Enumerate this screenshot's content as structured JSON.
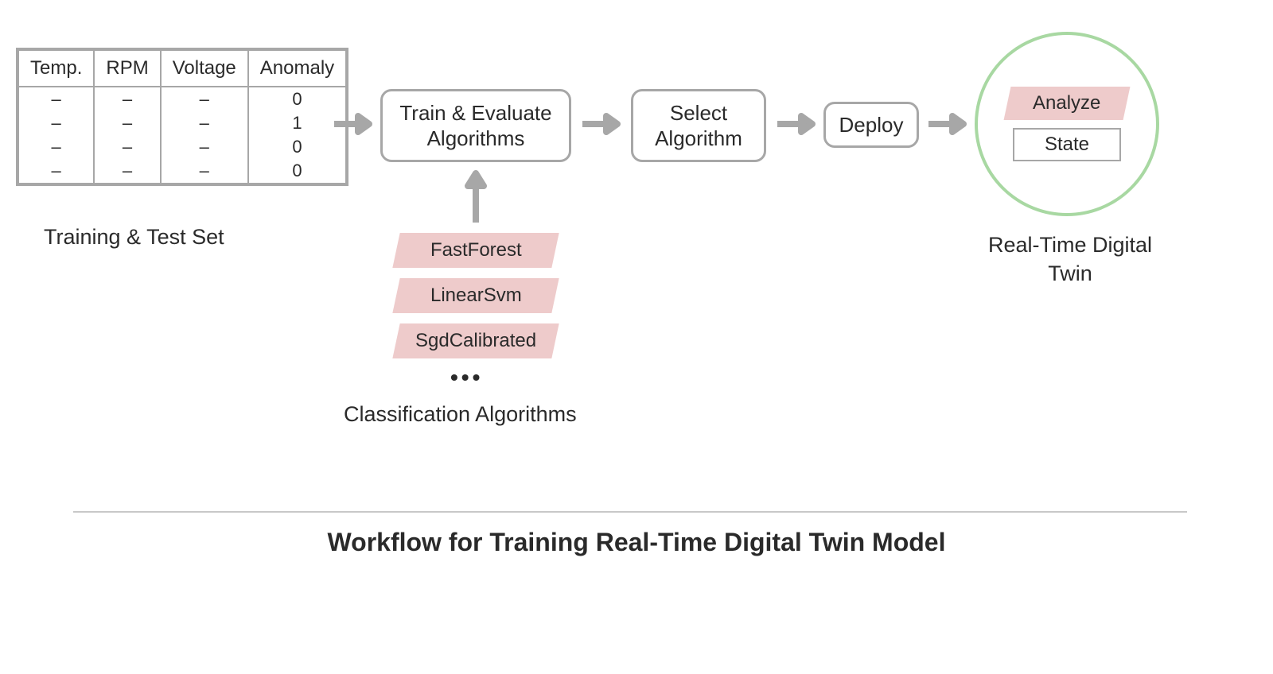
{
  "table": {
    "headers": [
      "Temp.",
      "RPM",
      "Voltage",
      "Anomaly"
    ],
    "rows": [
      [
        "–",
        "–",
        "–",
        "0"
      ],
      [
        "–",
        "–",
        "–",
        "1"
      ],
      [
        "–",
        "–",
        "–",
        "0"
      ],
      [
        "–",
        "–",
        "–",
        "0"
      ]
    ],
    "caption": "Training & Test Set"
  },
  "flow": {
    "train": "Train & Evaluate Algorithms",
    "select": "Select Algorithm",
    "deploy": "Deploy"
  },
  "classification": {
    "items": [
      "FastForest",
      "LinearSvm",
      "SgdCalibrated"
    ],
    "ellipsis": "•••",
    "caption": "Classification Algorithms"
  },
  "twin": {
    "analyze": "Analyze",
    "state": "State",
    "caption": "Real-Time Digital Twin"
  },
  "footer": "Workflow for Training Real-Time Digital Twin Model",
  "colors": {
    "border_gray": "#a7a7a7",
    "pink": "#eecbcb",
    "green": "#a8d8a2"
  }
}
